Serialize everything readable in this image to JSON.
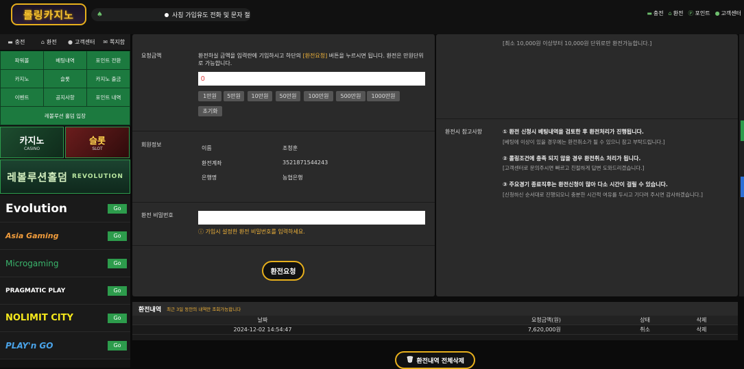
{
  "header": {
    "logo_text": "롤링카지노",
    "notice_text": "사칭 가입유도 전화 및 문자 절",
    "links": [
      "충전",
      "환전",
      "포인트",
      "고객센터"
    ]
  },
  "sidebar": {
    "tabs": [
      "충전",
      "환전",
      "고객센터",
      "쪽지함"
    ],
    "menu": [
      "파워볼",
      "베팅내역",
      "포인트 전환",
      "카지노",
      "슬롯",
      "카지노 출금",
      "이벤트",
      "공지사항",
      "포인트 내역",
      "레볼루션 홀덤 입장"
    ],
    "banner_casino": "카지노",
    "banner_casino_sub": "CASINO",
    "banner_slot": "슬롯",
    "banner_slot_sub": "SLOT",
    "banner_revolution": "레볼루션홀덤",
    "banner_revolution_sub": "REVOLUTION",
    "providers": [
      "Evolution",
      "Asia Gaming",
      "Microgaming",
      "PRAGMATIC PLAY",
      "NOLIMIT CITY",
      "PLAY'n GO"
    ],
    "go_label": "Go"
  },
  "form": {
    "amount_label": "요청금액",
    "amount_desc_1": "환전하실 금액을 입력란에 기입하시고 하단의 ",
    "amount_desc_hl": "[환전요청]",
    "amount_desc_2": " 버튼을 누르시면 됩니다. 환전은 만원단위로 가능합니다.",
    "amount_value": "0",
    "amount_buttons": [
      "1만원",
      "5만원",
      "10만원",
      "50만원",
      "100만원",
      "500만원",
      "1000만원"
    ],
    "reset_label": "초기화",
    "member_label": "회원정보",
    "name_key": "이름",
    "name_value": "조청훈",
    "account_key": "환전계좌",
    "account_value": "3521871544243",
    "bank_key": "은행명",
    "bank_value": "농협은행",
    "password_label": "환전 비밀번호",
    "password_hint": "가입시 설정한 환전 비밀번호를 입력하세요.",
    "submit_label": "환전요청"
  },
  "notes": {
    "top_note": "[최소 10,000원 이상부터 10,000원 단위로만 환전가능합니다.]",
    "label": "환전시 참고사항",
    "item1": "① 환전 신청시 베팅내역을 검토한 후 환전처리가 진행됩니다.",
    "item1_sub": "[베팅에 이상이 있을 경우에는 환전취소가 될 수 있으니 참고 부탁드립니다.]",
    "item2": "② 롤링조건에 충족 되지 않을 경우 환전취소 처리가 됩니다.",
    "item2_sub": "[고객센터로 문의주시면 빠르고 친절하게 답변 도와드리겠습니다.]",
    "item3": "③ 주요경기 종료직후는 환전신청이 많아 다소 시간이 걸릴 수 있습니다.",
    "item3_sub": "[신청하신 순서대로 진행되오니 충분한 시간적 여유를 두시고 기다려 주시면 감사하겠습니다.]"
  },
  "history": {
    "title": "환전내역",
    "subtitle": "최근 3일 동안의 내역만 조회가능합니다",
    "columns": [
      "날짜",
      "요청금액(원)",
      "상태",
      "삭제"
    ],
    "rows": [
      {
        "date": "2024-12-02 14:54:47",
        "amount": "7,620,000원",
        "status": "취소",
        "delete": "삭제"
      }
    ],
    "delete_all_label": "환전내역 전체삭제"
  },
  "colors": {
    "accent": "#e8b01c",
    "green": "#2d9c4c"
  }
}
